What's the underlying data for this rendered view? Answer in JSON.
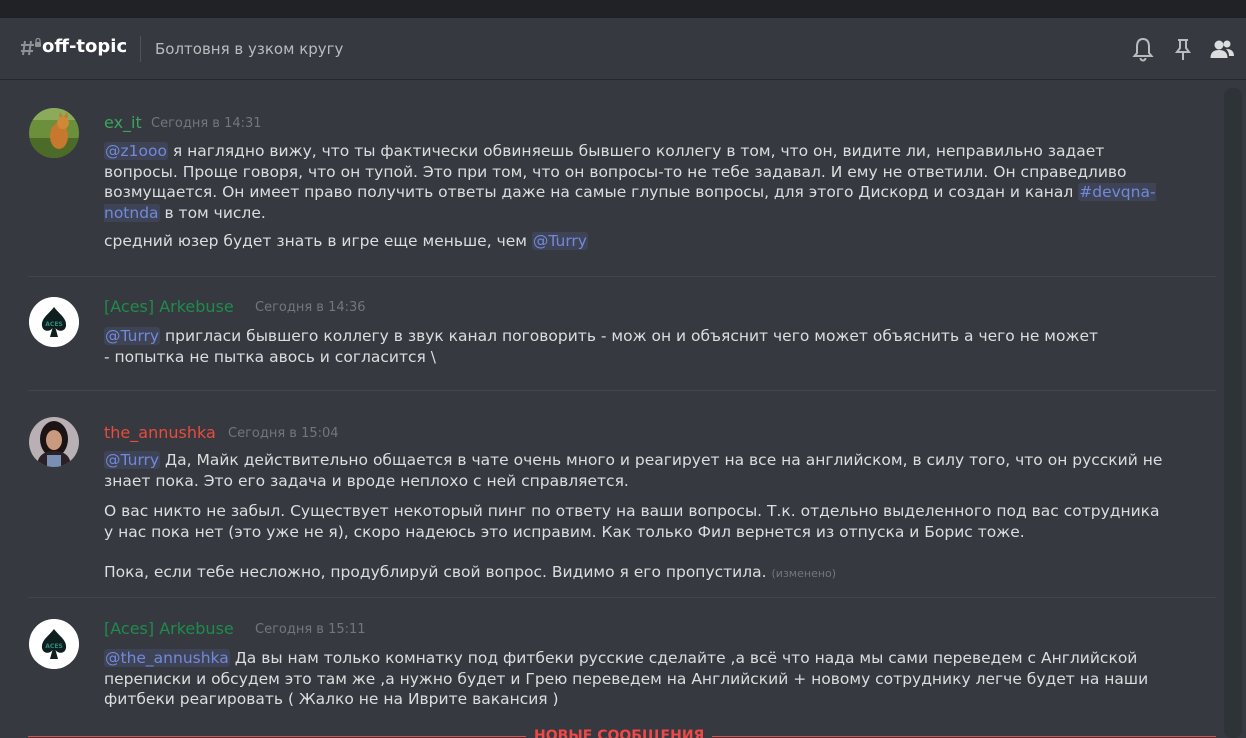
{
  "header": {
    "channel_icon": "hashtag-lock-icon",
    "channel_name": "off-topic",
    "topic": "Болтовня в узком кругу",
    "icons": [
      "bell-icon",
      "pin-icon",
      "members-icon"
    ]
  },
  "messages": [
    {
      "author": "ex_it",
      "author_color": "#3ba55c",
      "timestamp": "Сегодня в 14:31",
      "p1_mention": "@z1ooo",
      "p1_text": " я наглядно вижу, что ты фактически обвиняешь бывшего коллегу в том, что он, видите ли, неправильно задает вопросы. Проще говоря, что он тупой. Это при том, что он вопросы-то не тебе задавал. И ему не ответили. Он справедливо возмущается. Он имеет право получить ответы даже на самые глупые вопросы, для этого Дискорд и создан и канал ",
      "p1_channel": "#devqna-notnda",
      "p1_end": " в том числе.",
      "p2_text": "средний юзер будет знать в игре еще меньше, чем ",
      "p2_mention": "@Turry"
    },
    {
      "author": "[Aces] Arkebuse",
      "author_color": "#1f8b4c",
      "timestamp": "Сегодня в 14:36",
      "mention": "@Turry",
      "text": " пригласи бывшего коллегу в звук канал поговорить - мож он и объяснит чего может объяснить а чего не может - попытка не пытка авось и согласится \\"
    },
    {
      "author": "the_annushka",
      "author_color": "#e74c3c",
      "timestamp": "Сегодня в 15:04",
      "mention": "@Turry",
      "text1": " Да, Майк действительно общается в чате очень много и реагирует на все на английском, в силу того, что он русский не знает пока. Это его задача и вроде неплохо с ней справляется.",
      "text2": "О вас  никто не забыл. Существует некоторый пинг по ответу на ваши вопросы. Т.к. отдельно выделенного под вас сотрудника у нас пока нет (это уже не я), скоро надеюсь это исправим. Как только Фил вернется из отпуска и Борис тоже.",
      "text3": "Пока, если тебе несложно, продублируй свой вопрос. Видимо я его пропустила.",
      "edited": "(изменено)"
    },
    {
      "author": "[Aces] Arkebuse",
      "author_color": "#1f8b4c",
      "timestamp": "Сегодня в 15:11",
      "mention": "@the_annushka",
      "text": " Да вы нам только комнатку под фитбеки русские сделайте ,а всё что нада мы сами переведем с Английской переписки  и обсудем это там же  ,а нужно будет и Грею переведем на Английский  + новому сотруднику легче будет на наши фитбеки реагировать ( Жалко не на Иврите  вакансия )"
    }
  ],
  "divider_label": "НОВЫЕ СООБЩЕНИЯ",
  "aces_badge_text": "ACES"
}
